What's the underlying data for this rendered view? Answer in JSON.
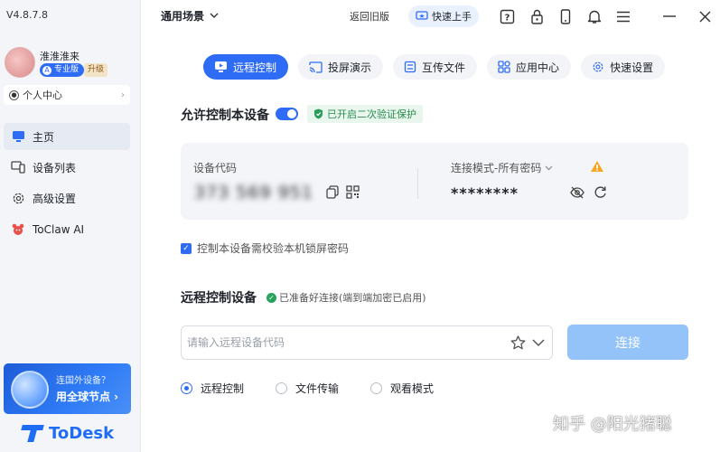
{
  "app": {
    "version": "V4.8.7.8",
    "brand": "ToDesk",
    "accent_color": "#2f6cf6"
  },
  "user": {
    "name": "淮淮淮来",
    "edition": "专业版",
    "upgrade": "升级",
    "personal_center": "个人中心"
  },
  "sidebar": {
    "items": [
      {
        "label": "主页",
        "icon": "monitor-icon",
        "active": true
      },
      {
        "label": "设备列表",
        "icon": "devices-icon",
        "active": false
      },
      {
        "label": "高级设置",
        "icon": "gear-icon",
        "active": false
      },
      {
        "label": "ToClaw AI",
        "icon": "claw-icon",
        "active": false
      }
    ],
    "promo": {
      "line1": "连国外设备？",
      "line2": "用全球节点 ›"
    }
  },
  "topbar": {
    "scene": "通用场景",
    "back_old": "返回旧版",
    "quick_start": "快速上手",
    "icons": [
      "help-icon",
      "lock-icon",
      "phone-icon",
      "bell-icon",
      "menu-icon",
      "minimize-icon",
      "close-icon"
    ]
  },
  "tabs": [
    {
      "label": "远程控制",
      "icon": "monitor-icon",
      "active": true
    },
    {
      "label": "投屏演示",
      "icon": "cast-icon",
      "active": false
    },
    {
      "label": "互传文件",
      "icon": "file-transfer-icon",
      "active": false
    },
    {
      "label": "应用中心",
      "icon": "apps-icon",
      "active": false
    },
    {
      "label": "快速设置",
      "icon": "gear-icon",
      "active": false
    }
  ],
  "allow_control": {
    "title": "允许控制本设备",
    "enabled": true,
    "verify_badge": "已开启二次验证保护"
  },
  "device_card": {
    "code_label": "设备代码",
    "code_value": "373 569 951",
    "mode_label": "连接模式-所有密码",
    "password": "********"
  },
  "lock_check": {
    "label": "控制本设备需校验本机锁屏密码",
    "checked": true
  },
  "remote": {
    "title": "远程控制设备",
    "ready": "已准备好连接(端到端加密已启用)",
    "input_placeholder": "请输入远程设备代码",
    "connect": "连接",
    "modes": [
      {
        "label": "远程控制",
        "selected": true
      },
      {
        "label": "文件传输",
        "selected": false
      },
      {
        "label": "观看模式",
        "selected": false
      }
    ]
  },
  "watermark": "知乎 @阳光猪聪"
}
